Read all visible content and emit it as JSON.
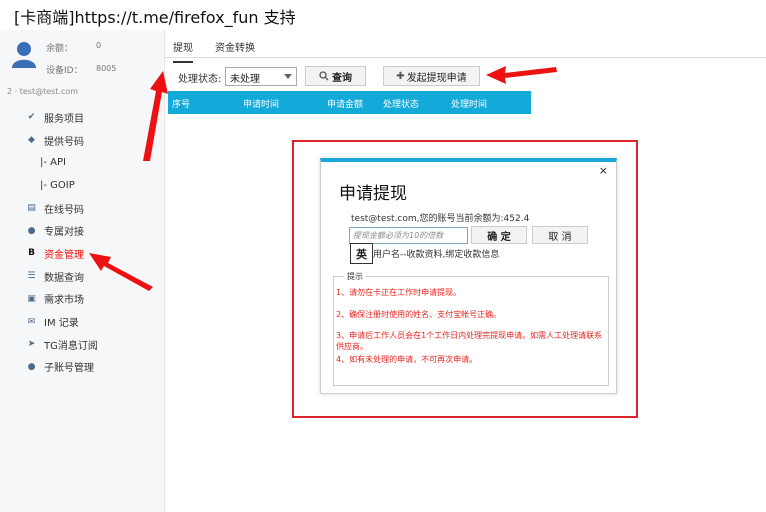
{
  "page_title": "[卡商端]https://t.me/firefox_fun 支持",
  "sidebar": {
    "balance_label": "余额：",
    "balance_value": "0",
    "device_label": "设备ID：",
    "device_value": "8005",
    "user_line": "2 · test@test.com",
    "items": [
      {
        "label": "服务项目",
        "icon": "tag-icon"
      },
      {
        "label": "提供号码",
        "icon": "diamond-icon"
      },
      {
        "label": "|-  API",
        "icon": ""
      },
      {
        "label": "|-  GOIP",
        "icon": ""
      },
      {
        "label": "在线号码",
        "icon": "list-icon"
      },
      {
        "label": "专属对接",
        "icon": "globe-icon"
      },
      {
        "label": "资金管理",
        "icon": "bold-b-icon"
      },
      {
        "label": "数据查询",
        "icon": "list-icon"
      },
      {
        "label": "需求市场",
        "icon": "doc-icon"
      },
      {
        "label": "IM 记录",
        "icon": "mail-icon"
      },
      {
        "label": "TG消息订阅",
        "icon": "telegram-icon"
      },
      {
        "label": "子账号管理",
        "icon": "users-icon"
      }
    ]
  },
  "tabs": [
    "提现",
    "资金转换"
  ],
  "filter": {
    "status_label": "处理状态:",
    "status_value": "未处理",
    "query_label": "查询",
    "apply_label": "发起提现申请"
  },
  "table": {
    "columns": [
      "序号",
      "申请时间",
      "申请金额",
      "处理状态",
      "处理时间"
    ]
  },
  "dialog": {
    "title": "申请提现",
    "account_text": "test@test.com,您的账号当前余额为:452.4",
    "amount_placeholder": "提现金额必须为10的倍数",
    "ok_label": "确 定",
    "cancel_label": "取 消",
    "ime_glyph": "英",
    "bind_text": "用户名--收款资料,绑定收款信息",
    "close_glyph": "×",
    "tips_label": "提示",
    "tips": [
      "1、请勿在卡正在工作时申请提现。",
      "2、确保注册时使用的姓名、支付宝帐号正确。",
      "3、申请后工作人员会在1个工作日内处理完提现申请。如需人工处理请联系供应商。",
      "4、如有未处理的申请，不可再次申请。"
    ]
  },
  "colors": {
    "accent": "#13a9d9",
    "annotation": "#d9252b",
    "tip_text": "#e6261f"
  }
}
